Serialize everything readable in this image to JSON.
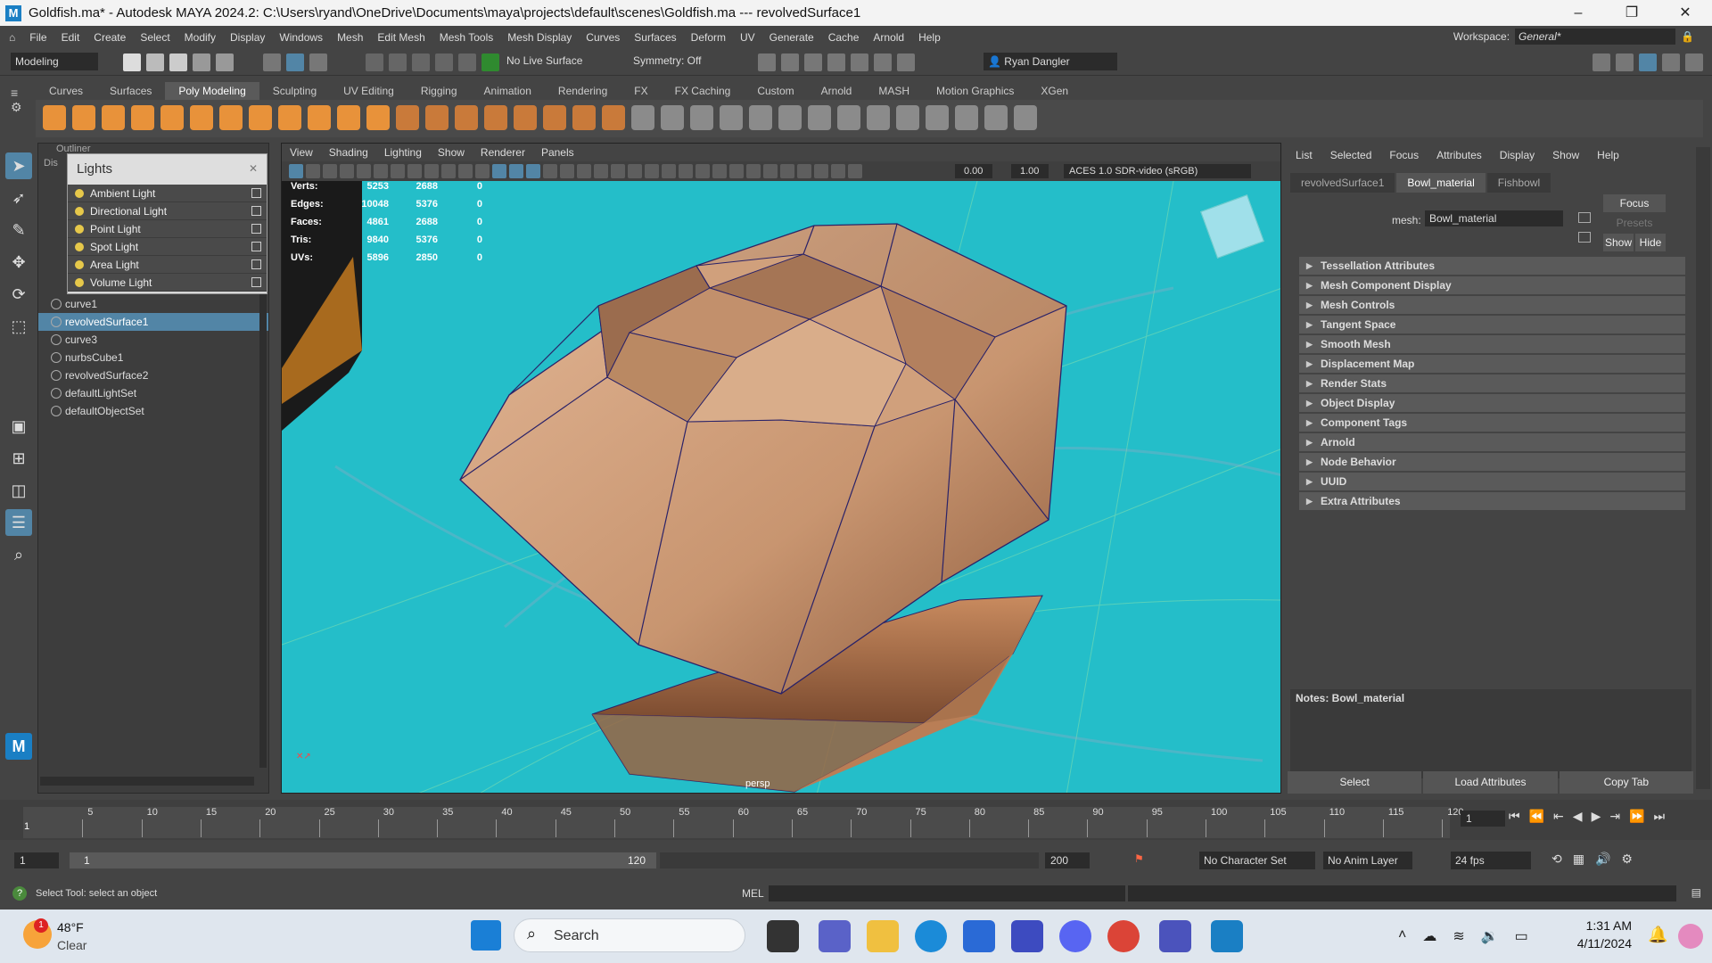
{
  "window": {
    "title": "Goldfish.ma* - Autodesk MAYA 2024.2: C:\\Users\\ryand\\OneDrive\\Documents\\maya\\projects\\default\\scenes\\Goldfish.ma   ---   revolvedSurface1",
    "app_icon": "M"
  },
  "menu": [
    "File",
    "Edit",
    "Create",
    "Select",
    "Modify",
    "Display",
    "Windows",
    "Mesh",
    "Edit Mesh",
    "Mesh Tools",
    "Mesh Display",
    "Curves",
    "Surfaces",
    "Deform",
    "UV",
    "Generate",
    "Cache",
    "Arnold",
    "Help"
  ],
  "workspace": {
    "label": "Workspace:",
    "value": "General*"
  },
  "statusline": {
    "mode": "Modeling",
    "live_surface": "No Live Surface",
    "symmetry": "Symmetry: Off",
    "user": "Ryan Dangler"
  },
  "shelf_tabs": [
    "Curves",
    "Surfaces",
    "Poly Modeling",
    "Sculpting",
    "UV Editing",
    "Rigging",
    "Animation",
    "Rendering",
    "FX",
    "FX Caching",
    "Custom",
    "Arnold",
    "MASH",
    "Motion Graphics",
    "XGen"
  ],
  "outliner": {
    "title": "Outliner",
    "sub": "Dis",
    "items": [
      "curve1",
      "revolvedSurface1",
      "curve3",
      "nurbsCube1",
      "revolvedSurface2",
      "defaultLightSet",
      "defaultObjectSet"
    ],
    "selected": "revolvedSurface1"
  },
  "lights": {
    "title": "Lights",
    "items": [
      "Ambient Light",
      "Directional Light",
      "Point Light",
      "Spot Light",
      "Area Light",
      "Volume Light"
    ]
  },
  "viewport": {
    "menu": [
      "View",
      "Shading",
      "Lighting",
      "Show",
      "Renderer",
      "Panels"
    ],
    "val1": "0.00",
    "val2": "1.00",
    "colorspace": "ACES 1.0 SDR-video (sRGB)",
    "camera": "persp",
    "hud": [
      {
        "k": "Verts:",
        "a": "5253",
        "b": "2688",
        "c": "0"
      },
      {
        "k": "Edges:",
        "a": "10048",
        "b": "5376",
        "c": "0"
      },
      {
        "k": "Faces:",
        "a": "4861",
        "b": "2688",
        "c": "0"
      },
      {
        "k": "Tris:",
        "a": "9840",
        "b": "5376",
        "c": "0"
      },
      {
        "k": "UVs:",
        "a": "5896",
        "b": "2850",
        "c": "0"
      }
    ]
  },
  "attr": {
    "menu": [
      "List",
      "Selected",
      "Focus",
      "Attributes",
      "Display",
      "Show",
      "Help"
    ],
    "tabs": [
      "revolvedSurface1",
      "Bowl_material",
      "Fishbowl"
    ],
    "active_tab": "Bowl_material",
    "mesh_label": "mesh:",
    "mesh_value": "Bowl_material",
    "focus": "Focus",
    "presets": "Presets",
    "show": "Show",
    "hide": "Hide",
    "sections": [
      "Tessellation Attributes",
      "Mesh Component Display",
      "Mesh Controls",
      "Tangent Space",
      "Smooth Mesh",
      "Displacement Map",
      "Render Stats",
      "Object Display",
      "Component Tags",
      "Arnold",
      "Node Behavior",
      "UUID",
      "Extra Attributes"
    ],
    "notes": "Notes:  Bowl_material",
    "buttons": [
      "Select",
      "Load Attributes",
      "Copy Tab"
    ]
  },
  "timeline": {
    "ticks": [
      "5",
      "10",
      "15",
      "20",
      "25",
      "30",
      "35",
      "40",
      "45",
      "50",
      "55",
      "60",
      "65",
      "70",
      "75",
      "80",
      "85",
      "90",
      "95",
      "100",
      "105",
      "110",
      "115",
      "120"
    ],
    "start": "1",
    "current": "1"
  },
  "range": {
    "start": "1",
    "inner_start": "1",
    "inner_end": "120",
    "end": "200",
    "char_set": "No Character Set",
    "anim_layer": "No Anim Layer",
    "fps": "24 fps"
  },
  "cmd": {
    "help": "Select Tool: select an object",
    "lang": "MEL"
  },
  "taskbar": {
    "weather_temp": "48°F",
    "weather_desc": "Clear",
    "weather_badge": "1",
    "search": "Search",
    "time": "1:31 AM",
    "date": "4/11/2024"
  }
}
